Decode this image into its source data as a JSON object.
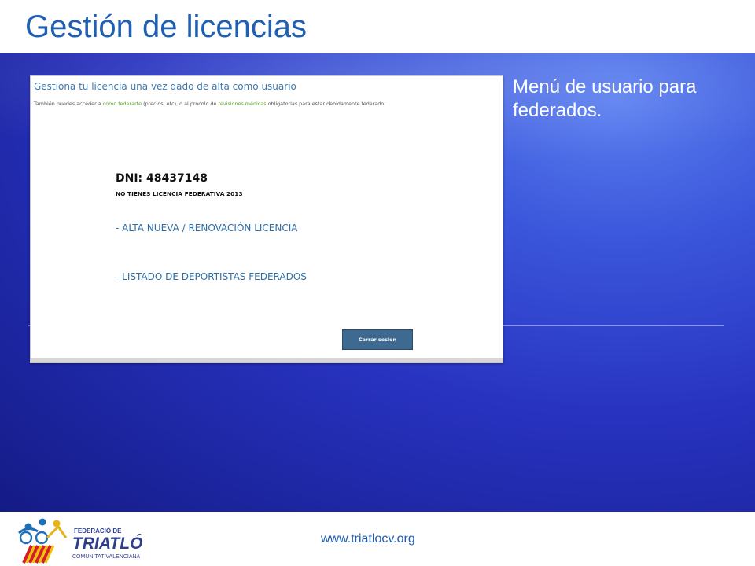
{
  "slide": {
    "title": "Gestión de licencias",
    "caption": "Menú de usuario para federados.",
    "footer_url": "www.triatlocv.org"
  },
  "screenshot": {
    "heading": "Gestiona tu licencia una vez dado de alta como usuario",
    "subtitle_prefix": "También puedes acceder a ",
    "subtitle_link1": "como federarte",
    "subtitle_mid": " (precios, etc), o al procolo de ",
    "subtitle_link2": "revisiones médicas",
    "subtitle_suffix": " obligatorias para estar debidamente federado.",
    "dni": "DNI: 48437148",
    "license_status": "NO TIENES LICENCIA FEDERATIVA 2013",
    "link_alta": "- ALTA NUEVA / RENOVACIÓN LICENCIA",
    "link_listado": "- LISTADO DE DEPORTISTAS FEDERADOS",
    "logout_label": "Cerrar sesion"
  },
  "logo": {
    "line1": "FEDERACIÓ DE",
    "line2": "TRIATLÓ",
    "line3": "COMUNITAT VALENCIANA"
  },
  "colors": {
    "title_blue": "#1f5fb4",
    "link_blue": "#2e6ea6",
    "link_green": "#5aa12c",
    "button": "#3e6a91",
    "background_dark": "#141b86",
    "background_light": "#5a7ff0"
  }
}
